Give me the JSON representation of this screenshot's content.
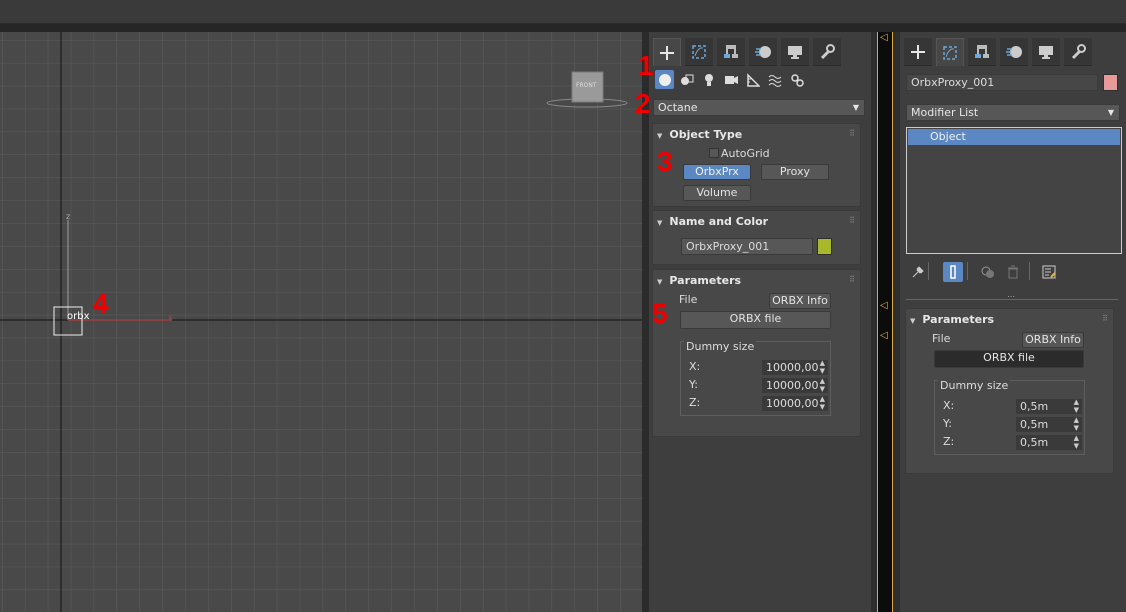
{
  "annotations": {
    "n1": "1",
    "n2": "2",
    "n3": "3",
    "n4": "4",
    "n5": "5"
  },
  "viewport": {
    "axis_z": "z",
    "axis_x": "x",
    "object_label": "orbx",
    "viewcube_label": "FRONT"
  },
  "command_tabs": [
    "create-icon",
    "modify-icon",
    "hierarchy-icon",
    "motion-icon",
    "display-icon",
    "utilities-icon"
  ],
  "create_panel": {
    "category_icons": [
      "geometry-icon",
      "shapes-icon",
      "lights-icon",
      "cameras-icon",
      "helpers-icon",
      "spacewarps-icon",
      "systems-icon"
    ],
    "category_dropdown": "Octane",
    "object_type": {
      "title": "Object Type",
      "autogrid_label": "AutoGrid",
      "buttons": [
        "OrbxPrx",
        "Proxy",
        "Volume"
      ]
    },
    "name_color": {
      "title": "Name and Color",
      "name_value": "OrbxProxy_001",
      "color": "#a7b82b"
    },
    "parameters": {
      "title": "Parameters",
      "file_label": "File",
      "info_button": "ORBX Info",
      "file_button": "ORBX file",
      "dummy_group": "Dummy size",
      "x_label": "X:",
      "x_value": "10000,00",
      "y_label": "Y:",
      "y_value": "10000,00",
      "z_label": "Z:",
      "z_value": "10000,00"
    }
  },
  "modify_panel": {
    "object_name": "OrbxProxy_001",
    "object_color": "#e89a9a",
    "modifier_list": "Modifier List",
    "stack_items": [
      "Object"
    ],
    "parameters": {
      "title": "Parameters",
      "file_label": "File",
      "info_button": "ORBX Info",
      "file_button": "ORBX file",
      "dummy_group": "Dummy size",
      "x_label": "X:",
      "x_value": "0,5m",
      "y_label": "Y:",
      "y_value": "0,5m",
      "z_label": "Z:",
      "z_value": "0,5m"
    }
  },
  "colors": {
    "accent": "#5b88c2",
    "annotation": "#e00000",
    "strip_border": "#d9a93f"
  }
}
